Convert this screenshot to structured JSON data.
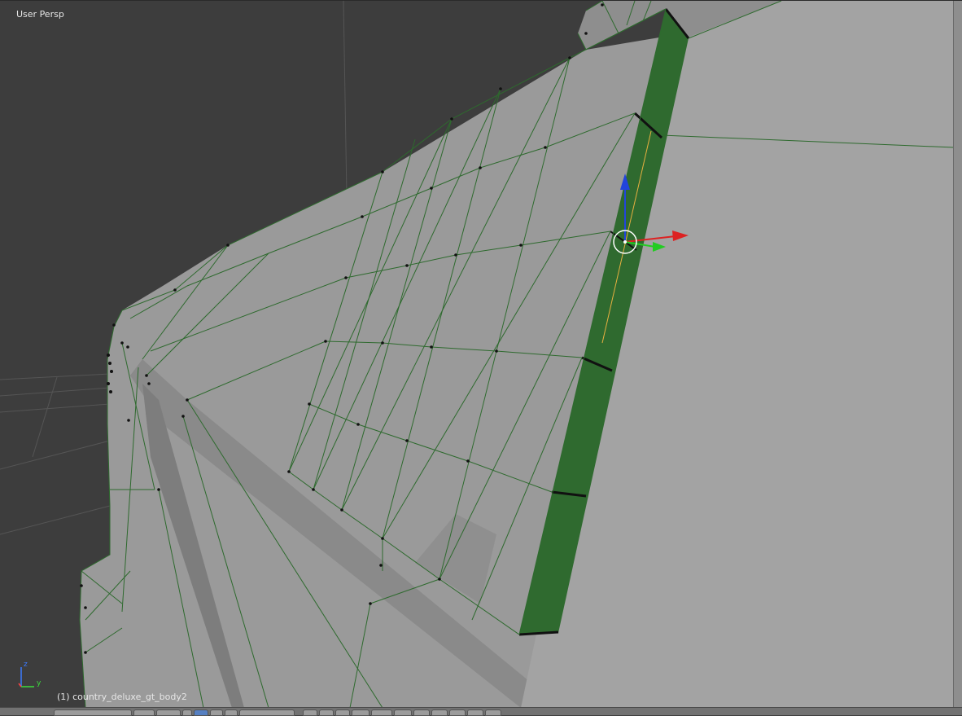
{
  "viewport": {
    "view_label": "User Persp",
    "object_label": "(1) country_deluxe_gt_body2",
    "axes": {
      "z": "z",
      "y": "y"
    }
  },
  "colors": {
    "background": "#3d3d3d",
    "mesh_face": "#9a9a9a",
    "wire": "#2e6a2e",
    "selected_face": "#2f6a2f",
    "gizmo_x": "#dd2222",
    "gizmo_y": "#22cc22",
    "gizmo_z": "#2244dd"
  },
  "header": {
    "buttons": [
      {
        "name": "editor-type-button",
        "icon": "view3d-icon"
      },
      {
        "name": "view-menu-button",
        "icon": "menu-icon"
      },
      {
        "name": "select-menu-button",
        "icon": "menu-icon"
      },
      {
        "name": "mode-dropdown",
        "icon": "mode-icon"
      },
      {
        "name": "shading-button",
        "icon": "sphere-icon"
      },
      {
        "name": "pivot-button",
        "icon": "pivot-icon"
      },
      {
        "name": "manipulator-button",
        "icon": "arrow-icon"
      },
      {
        "name": "translate-button",
        "icon": "arrow-icon"
      },
      {
        "name": "rotate-button",
        "icon": "arc-icon"
      },
      {
        "name": "scale-button",
        "icon": "box-icon"
      },
      {
        "name": "orientation-dropdown",
        "icon": "dropdown-icon"
      },
      {
        "name": "vertex-select-button",
        "icon": "vertex-icon"
      },
      {
        "name": "edge-select-button",
        "icon": "edge-icon"
      },
      {
        "name": "face-select-button",
        "icon": "face-icon"
      },
      {
        "name": "limit-selection-button",
        "icon": "cube-icon"
      },
      {
        "name": "proportional-edit-button",
        "icon": "circle-icon"
      },
      {
        "name": "snap-button",
        "icon": "magnet-icon"
      },
      {
        "name": "snap-element-button",
        "icon": "grid-icon"
      },
      {
        "name": "render-button",
        "icon": "camera-icon"
      },
      {
        "name": "opengl-render-button",
        "icon": "image-icon"
      }
    ]
  }
}
